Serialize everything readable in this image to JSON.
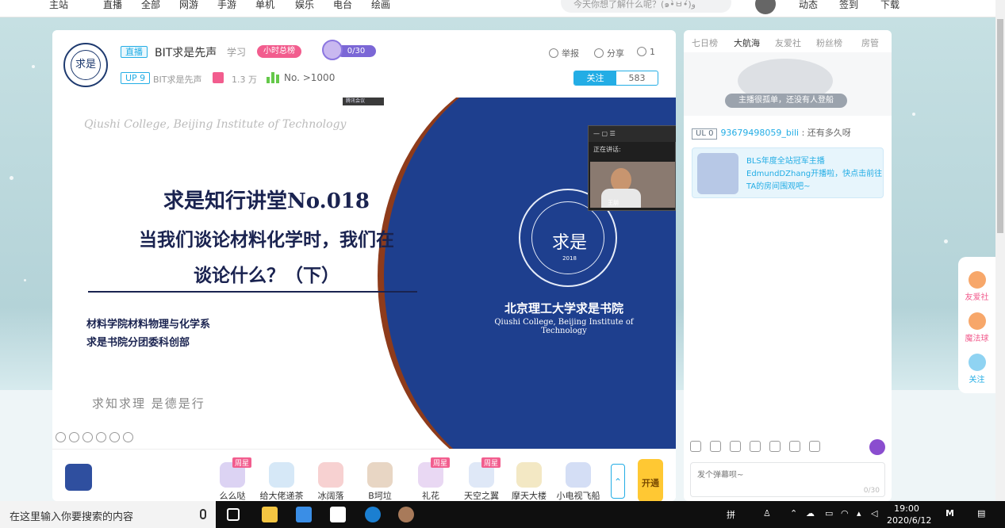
{
  "topnav": {
    "items": [
      "主站",
      "直播",
      "全部",
      "网游",
      "手游",
      "单机",
      "娱乐",
      "电台",
      "绘画"
    ],
    "search_placeholder": "今天你想了解什么呢？(๑•̀ㅂ•́)و",
    "right": [
      "动态",
      "签到",
      "下载"
    ]
  },
  "room": {
    "live_tag": "直播",
    "title": "BIT求是先声",
    "category": "学习",
    "rank_pill": "小时总榜",
    "guard_count": "0/30",
    "up_level": "UP 9",
    "anchor_name": "BIT求是先声",
    "gift_count": "1.3 万",
    "rank_text": "No. >1000",
    "report": "举报",
    "share": "分享",
    "viewers": "1",
    "follow_label": "关注",
    "follow_count": "583",
    "logo_text": "求是"
  },
  "slide": {
    "sub_en": "Qiushi College, Beijing Institute of Technology",
    "line1": "求是知行讲堂No.018",
    "line2": "当我们谈论材料化学时，我们在",
    "line3": "谈论什么？（下）",
    "dept1": "材料学院材料物理与化学系",
    "dept2": "求是书院分团委科创部",
    "motto": "求知求理  是德是行",
    "school_cn": "北京理工大学求是书院",
    "school_en": "Qiushi College, Beijing Institute of Technology",
    "seal_text": "求是",
    "seal_year": "2018",
    "meeting_tag": "腾讯会议"
  },
  "camera": {
    "speaking": "正在讲话:",
    "name": "王朋"
  },
  "gifts": [
    {
      "name": "么么哒",
      "hot": "周星"
    },
    {
      "name": "给大佬递茶",
      "hot": ""
    },
    {
      "name": "冰阔落",
      "hot": ""
    },
    {
      "name": "B坷垃",
      "hot": ""
    },
    {
      "name": "礼花",
      "hot": "周星"
    },
    {
      "name": "天空之翼",
      "hot": "周星"
    },
    {
      "name": "摩天大楼",
      "hot": ""
    },
    {
      "name": "小电视飞船",
      "hot": ""
    }
  ],
  "open_btn": "开通",
  "side": {
    "tabs": [
      "七日榜",
      "大航海",
      "友爱社",
      "粉丝榜",
      "房管"
    ],
    "empty_text": "主播很孤单，还没有人登船",
    "chat": {
      "level": "UL 0",
      "user": "93679498059_bili",
      "msg": "还有多久呀"
    },
    "notice": "BLS年度全站冠军主播EdmundDZhang开播啦，快点击前往TA的房间围观吧~",
    "input_placeholder": "发个弹幕呗~",
    "input_count": "0/30"
  },
  "floating": [
    "友爱社",
    "魔法球",
    "关注"
  ],
  "taskbar": {
    "search": "在这里输入你要搜索的内容",
    "ime": "拼",
    "time": "19:00",
    "date": "2020/6/12"
  }
}
